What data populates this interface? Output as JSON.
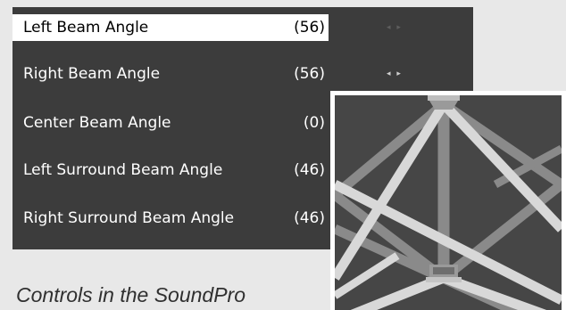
{
  "menu": {
    "items": [
      {
        "label": "Left Beam Angle",
        "value": "(56)",
        "selected": true
      },
      {
        "label": "Right Beam Angle",
        "value": "(56)",
        "selected": false
      },
      {
        "label": "Center Beam Angle",
        "value": "(0)",
        "selected": false
      },
      {
        "label": "Left Surround Beam Angle",
        "value": "(46)",
        "selected": false
      },
      {
        "label": "Right Surround Beam Angle",
        "value": "(46)",
        "selected": false
      }
    ],
    "arrow_glyph": "◂ ▸"
  },
  "caption": "Controls in the SoundPro",
  "colors": {
    "panel_background": "#3c3c3c",
    "selected_row_background": "#ffffff",
    "preview_background": "#464646",
    "beam_light": "#d8d8d8",
    "beam_mid": "#8a8a8a"
  },
  "icons": [
    "left-right-arrows-icon",
    "soundbar-speaker-icon"
  ]
}
